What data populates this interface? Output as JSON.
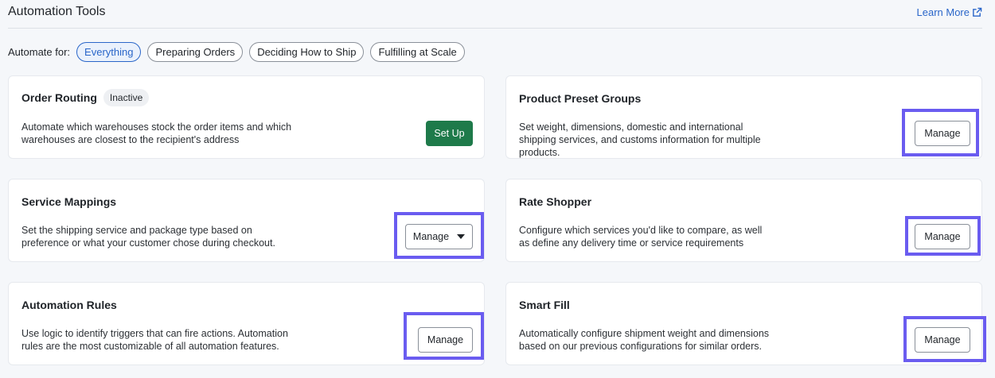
{
  "header": {
    "title": "Automation Tools",
    "learn_more": "Learn More",
    "learn_more_icon": "external-link-icon"
  },
  "filters": {
    "label": "Automate for:",
    "options": [
      "Everything",
      "Preparing Orders",
      "Deciding How to Ship",
      "Fulfilling at Scale"
    ],
    "selected": "Everything"
  },
  "cards": [
    {
      "title": "Order Routing",
      "badge": "Inactive",
      "description": "Automate which warehouses stock the order items and which warehouses are closest to the recipient's address",
      "action": "Set Up"
    },
    {
      "title": "Product Preset Groups",
      "description": "Set weight, dimensions, domestic and international shipping services, and customs information for multiple products.",
      "action": "Manage"
    },
    {
      "title": "Service Mappings",
      "description": "Set the shipping service and package type based on preference or what your customer chose during checkout.",
      "action": "Manage"
    },
    {
      "title": "Rate Shopper",
      "description": "Configure which services you'd like to compare, as well as define any delivery time or service requirements",
      "action": "Manage"
    },
    {
      "title": "Automation Rules",
      "description": "Use logic to identify triggers that can fire actions. Automation rules are the most customizable of all automation features.",
      "action": "Manage"
    },
    {
      "title": "Smart Fill",
      "description": "Automatically configure shipment weight and dimensions based on our previous configurations for similar orders.",
      "action": "Manage"
    }
  ],
  "colors": {
    "accent": "#2a66c9",
    "primary_button": "#1e7a4a",
    "highlight": "#6a5cf0"
  }
}
